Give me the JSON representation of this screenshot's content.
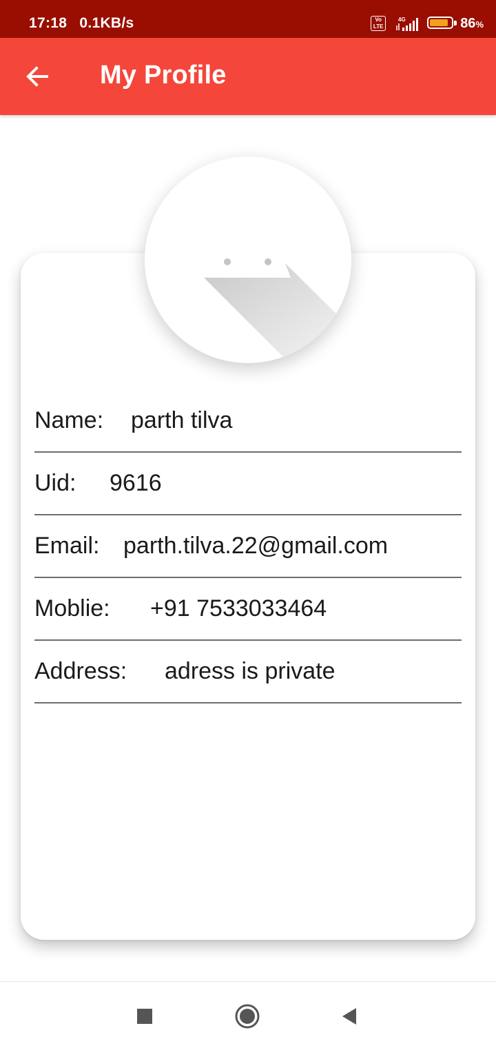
{
  "status_bar": {
    "time": "17:18",
    "speed": "0.1KB/s",
    "volte_badge_top": "Vo",
    "volte_badge_bottom": "LTE",
    "network_type": "4G",
    "battery_percent": "86",
    "battery_percent_unit": "%",
    "battery_level": 0.86,
    "background_color": "#9a0e02"
  },
  "app_bar": {
    "title": "My Profile",
    "back_icon": "arrow-back-icon",
    "background_color": "#f4463a"
  },
  "profile": {
    "avatar_icon": "default-avatar-icon",
    "fields": [
      {
        "label": "Name:",
        "value": "parth tilva"
      },
      {
        "label": "Uid:",
        "value": "9616"
      },
      {
        "label": "Email:",
        "value": "parth.tilva.22@gmail.com"
      },
      {
        "label": "Moblie:",
        "value": "+91 7533033464"
      },
      {
        "label": "Address:",
        "value": "adress is private"
      }
    ]
  },
  "nav_bar": {
    "recents_icon": "square-recents-icon",
    "home_icon": "circle-home-icon",
    "back_icon": "triangle-back-icon"
  }
}
